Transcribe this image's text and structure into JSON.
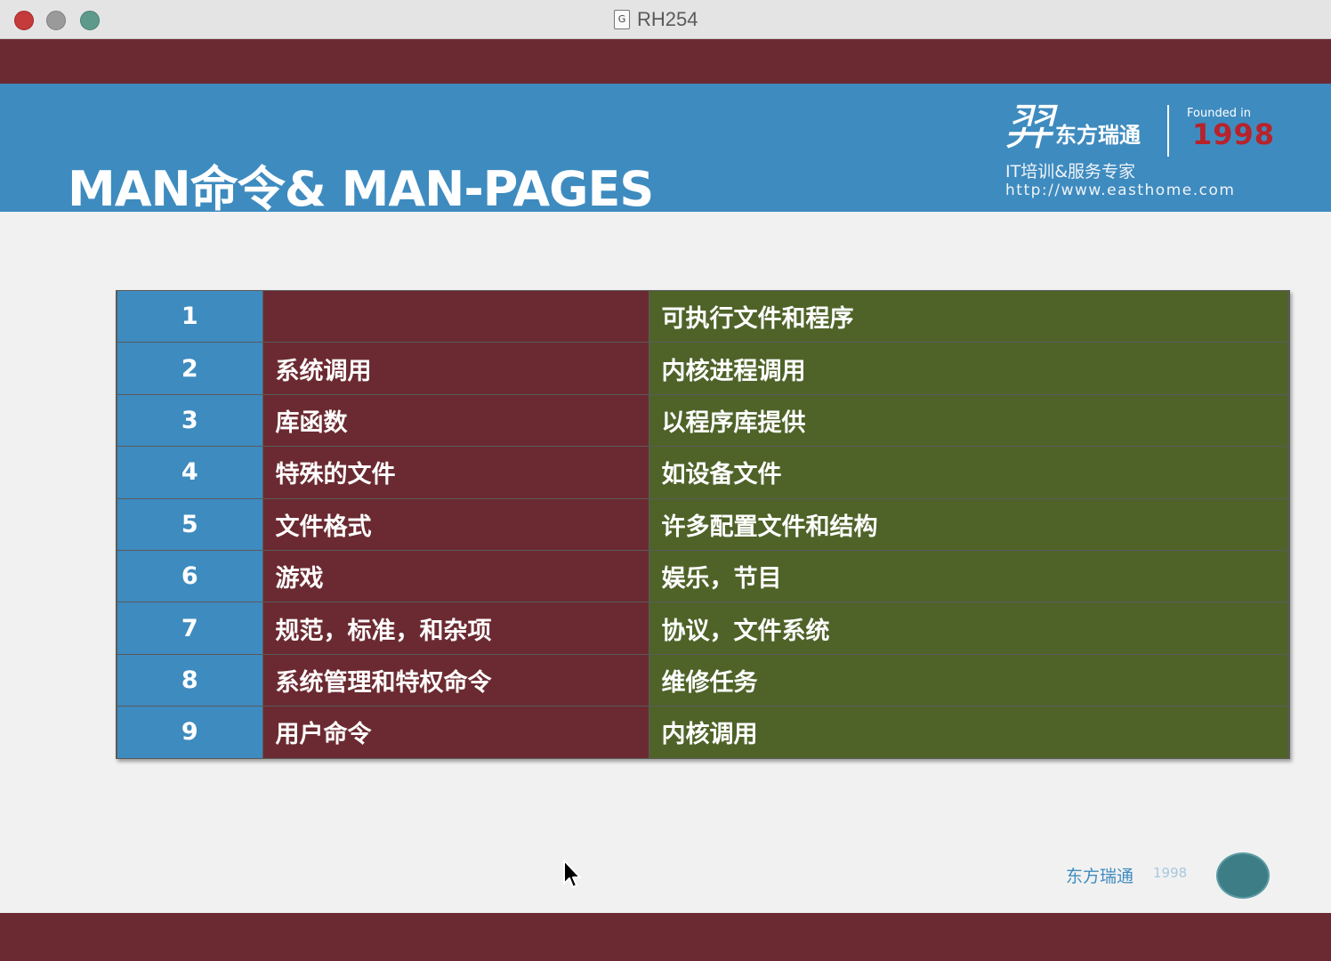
{
  "window": {
    "title": "RH254",
    "doc_icon_glyph": "G"
  },
  "header": {
    "title": "MAN命令& MAN-PAGES"
  },
  "logo": {
    "mark": "羿",
    "name": "东方瑞通",
    "founded_in": "Founded in",
    "year": "1998",
    "tagline": "IT培训&服务专家",
    "website": "http://www.easthome.com"
  },
  "table": {
    "rows": [
      {
        "num": "1",
        "name": "",
        "desc": "可执行文件和程序"
      },
      {
        "num": "2",
        "name": "系统调用",
        "desc": "内核进程调用"
      },
      {
        "num": "3",
        "name": "库函数",
        "desc": "以程序库提供"
      },
      {
        "num": "4",
        "name": "特殊的文件",
        "desc": "如设备文件"
      },
      {
        "num": "5",
        "name": "文件格式",
        "desc": "许多配置文件和结构"
      },
      {
        "num": "6",
        "name": "游戏",
        "desc": "娱乐，节目"
      },
      {
        "num": "7",
        "name": "规范，标准，和杂项",
        "desc": "协议，文件系统"
      },
      {
        "num": "8",
        "name": "系统管理和特权命令",
        "desc": "维修任务"
      },
      {
        "num": "9",
        "name": "用户命令",
        "desc": "内核调用"
      }
    ]
  },
  "footer": {
    "logo_text": "东方瑞通",
    "year_text": "1998"
  },
  "colors": {
    "maroon": "#6b2a31",
    "blue": "#3e8bbf",
    "olive": "#4f6329",
    "year_red": "#b8222a"
  },
  "icons": {
    "cursor": "arrow-cursor-icon"
  }
}
